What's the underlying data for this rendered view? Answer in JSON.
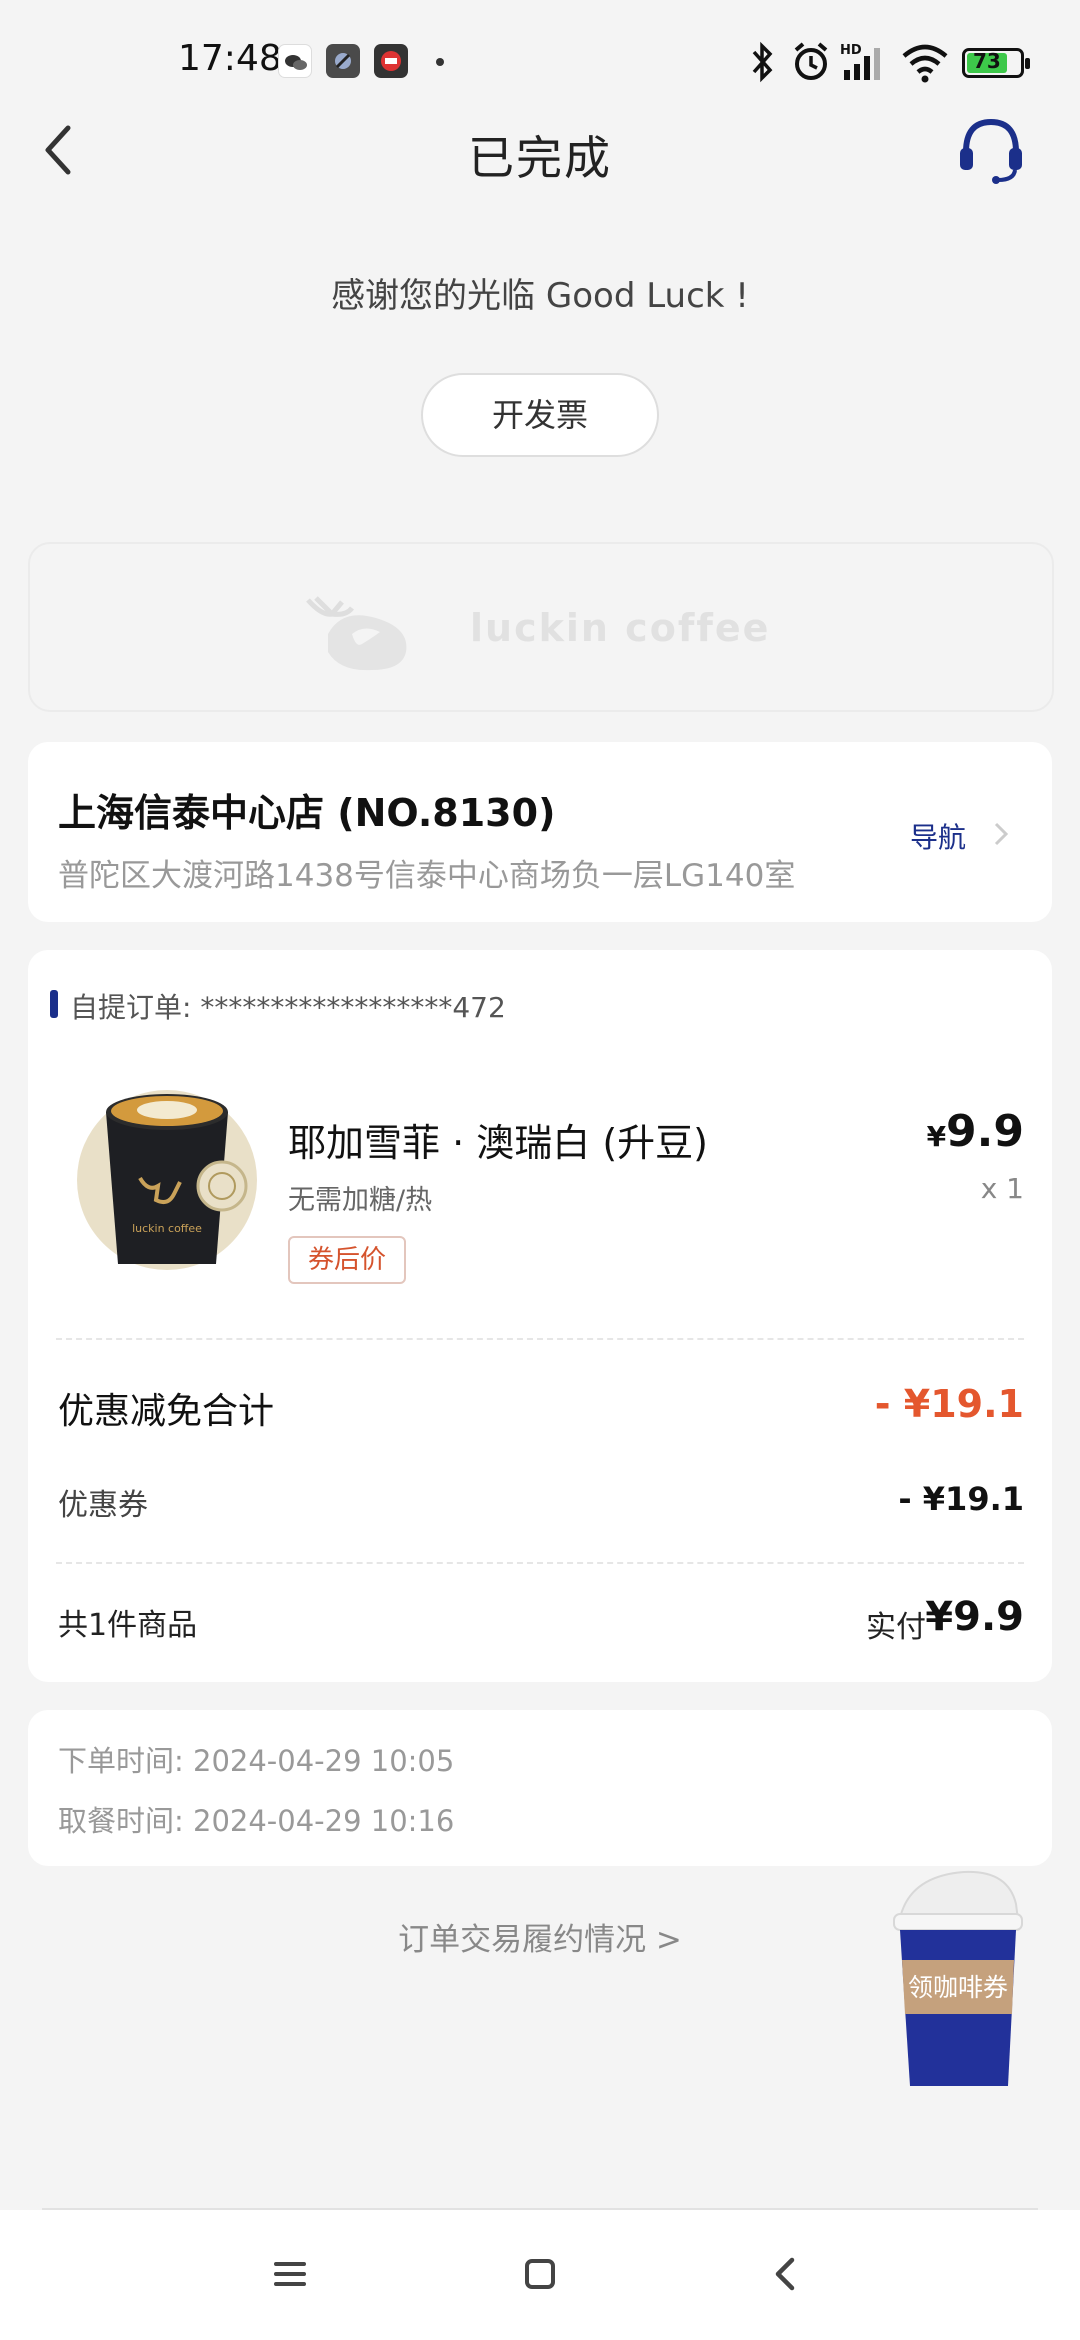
{
  "status_bar": {
    "time": "17:48",
    "battery": "73"
  },
  "header": {
    "title": "已完成"
  },
  "thanks_text": "感谢您的光临 Good Luck !",
  "invoice_button": "开发票",
  "brand": {
    "logo_text": "luckin coffee"
  },
  "store": {
    "name": "上海信泰中心店 (NO.8130)",
    "address": "普陀区大渡河路1438号信泰中心商场负一层LG140室",
    "nav_label": "导航"
  },
  "order": {
    "label": "自提订单: ******************472",
    "product": {
      "name": "耶加雪菲 · 澳瑞白 (升豆)",
      "spec": "无需加糖/热",
      "tag": "券后价",
      "currency": "¥",
      "price": "9.9",
      "qty": "x 1",
      "cup_brand": "luckin coffee"
    },
    "discount_label": "优惠减免合计",
    "discount_value": "- ¥19.1",
    "coupon_label": "优惠券",
    "coupon_value": "- ¥19.1",
    "count_label": "共1件商品",
    "paid_label": "实付",
    "paid_value": "¥9.9"
  },
  "times": {
    "order_time": "下单时间:  2024-04-29 10:05",
    "pickup_time": "取餐时间:  2024-04-29 10:16"
  },
  "fulfillment_link": "订单交易履约情况 >",
  "floating_coupon": "领咖啡券",
  "colors": {
    "brand_blue": "#1b2f8a",
    "discount_red": "#e4572e"
  }
}
